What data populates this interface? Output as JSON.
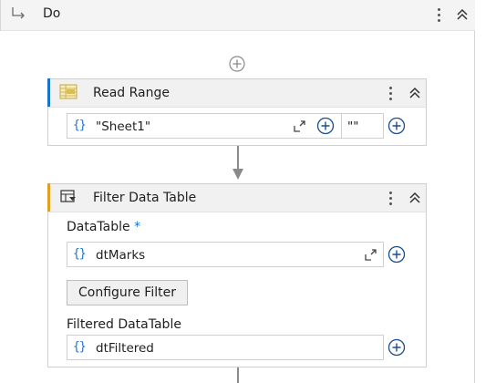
{
  "do_scope": {
    "title": "Do"
  },
  "read_range": {
    "title": "Read Range",
    "sheet_value": "\"Sheet1\"",
    "range_value": "\"\""
  },
  "filter_data_table": {
    "title": "Filter Data Table",
    "datatable_label": "DataTable",
    "required_marker": "*",
    "datatable_value": "dtMarks",
    "configure_button": "Configure Filter",
    "filtered_label": "Filtered DataTable",
    "filtered_value": "dtFiltered"
  },
  "icons": {
    "brace": "{}",
    "scope_arrow": "subdirectory-arrow-icon",
    "more": "kebab-menu-icon",
    "collapse": "double-chevron-up-icon",
    "add": "plus-circle-icon",
    "expand": "expand-corner-icon",
    "read_range_icon": "excel-range-icon",
    "filter_icon": "filter-table-icon"
  },
  "colors": {
    "read_range_accent": "#1b72c9",
    "filter_accent": "#e0a020",
    "brace_blue": "#1b72c9",
    "plus_blue": "#1b72c9"
  }
}
